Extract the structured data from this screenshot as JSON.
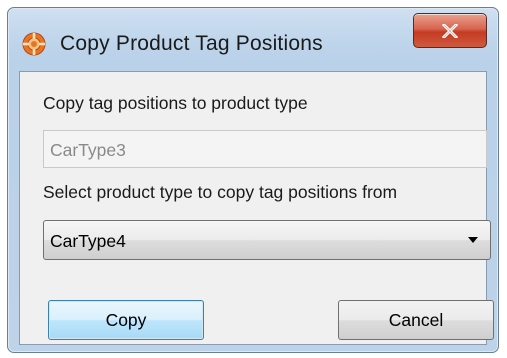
{
  "window": {
    "title": "Copy Product Tag Positions",
    "close_label": "X"
  },
  "form": {
    "target_label": "Copy tag positions to product type",
    "target_value": "CarType3",
    "source_label": "Select product type to copy tag positions from",
    "source_selected": "CarType4"
  },
  "buttons": {
    "copy_label": "Copy",
    "cancel_label": "Cancel"
  },
  "icons": {
    "app": "orange-ring-icon",
    "close": "close-icon",
    "dropdown": "dropdown-arrow-icon"
  },
  "colors": {
    "title_bar": "#bcd3ea",
    "close_button": "#c43b23",
    "client_bg": "#f0f0f0",
    "default_button_border": "#3c7fb1"
  }
}
